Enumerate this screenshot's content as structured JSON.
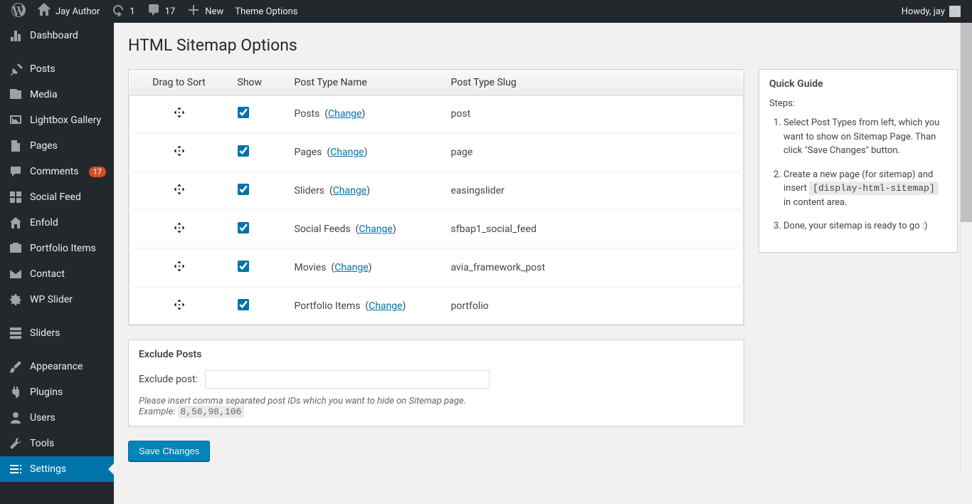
{
  "adminbar": {
    "site_name": "Jay Author",
    "updates_count": "1",
    "comments_count": "17",
    "new_label": "New",
    "theme_options": "Theme Options",
    "howdy": "Howdy, jay"
  },
  "sidebar": {
    "items": [
      {
        "label": "Dashboard",
        "icon": "dashboard"
      },
      {
        "label": "Posts",
        "icon": "pin"
      },
      {
        "label": "Media",
        "icon": "media"
      },
      {
        "label": "Lightbox Gallery",
        "icon": "gallery"
      },
      {
        "label": "Pages",
        "icon": "page"
      },
      {
        "label": "Comments",
        "icon": "comment",
        "badge": "17"
      },
      {
        "label": "Social Feed",
        "icon": "grid"
      },
      {
        "label": "Enfold",
        "icon": "home"
      },
      {
        "label": "Portfolio Items",
        "icon": "portfolio"
      },
      {
        "label": "Contact",
        "icon": "mail"
      },
      {
        "label": "WP Slider",
        "icon": "gear"
      },
      {
        "label": "Sliders",
        "icon": "sliders"
      },
      {
        "label": "Appearance",
        "icon": "brush"
      },
      {
        "label": "Plugins",
        "icon": "plug"
      },
      {
        "label": "Users",
        "icon": "user"
      },
      {
        "label": "Tools",
        "icon": "wrench"
      },
      {
        "label": "Settings",
        "icon": "settings",
        "active": true
      }
    ]
  },
  "page": {
    "title": "HTML Sitemap Options"
  },
  "table": {
    "headers": {
      "drag": "Drag to Sort",
      "show": "Show",
      "name": "Post Type Name",
      "slug": "Post Type Slug"
    },
    "change_label": "Change",
    "rows": [
      {
        "name": "Posts",
        "slug": "post",
        "checked": true
      },
      {
        "name": "Pages",
        "slug": "page",
        "checked": true
      },
      {
        "name": "Sliders",
        "slug": "easingslider",
        "checked": true
      },
      {
        "name": "Social Feeds",
        "slug": "sfbap1_social_feed",
        "checked": true
      },
      {
        "name": "Movies",
        "slug": "avia_framework_post",
        "checked": true
      },
      {
        "name": "Portfolio Items",
        "slug": "portfolio",
        "checked": true
      }
    ]
  },
  "exclude": {
    "heading": "Exclude Posts",
    "label": "Exclude post:",
    "value": "",
    "help": "Please insert comma separated post IDs which you want to hide on Sitemap page.",
    "example_label": "Example:",
    "example_value": "8,56,98,106"
  },
  "guide": {
    "heading": "Quick Guide",
    "steps_label": "Steps:",
    "steps": [
      "Select Post Types from left, which you want to show on Sitemap Page. Than click \"Save Changes\" button.",
      {
        "pre": "Create a new page (for sitemap) and insert ",
        "code": "[display-html-sitemap]",
        "post": " in content area."
      },
      "Done, your sitemap is ready to go :)"
    ]
  },
  "buttons": {
    "save": "Save Changes"
  }
}
